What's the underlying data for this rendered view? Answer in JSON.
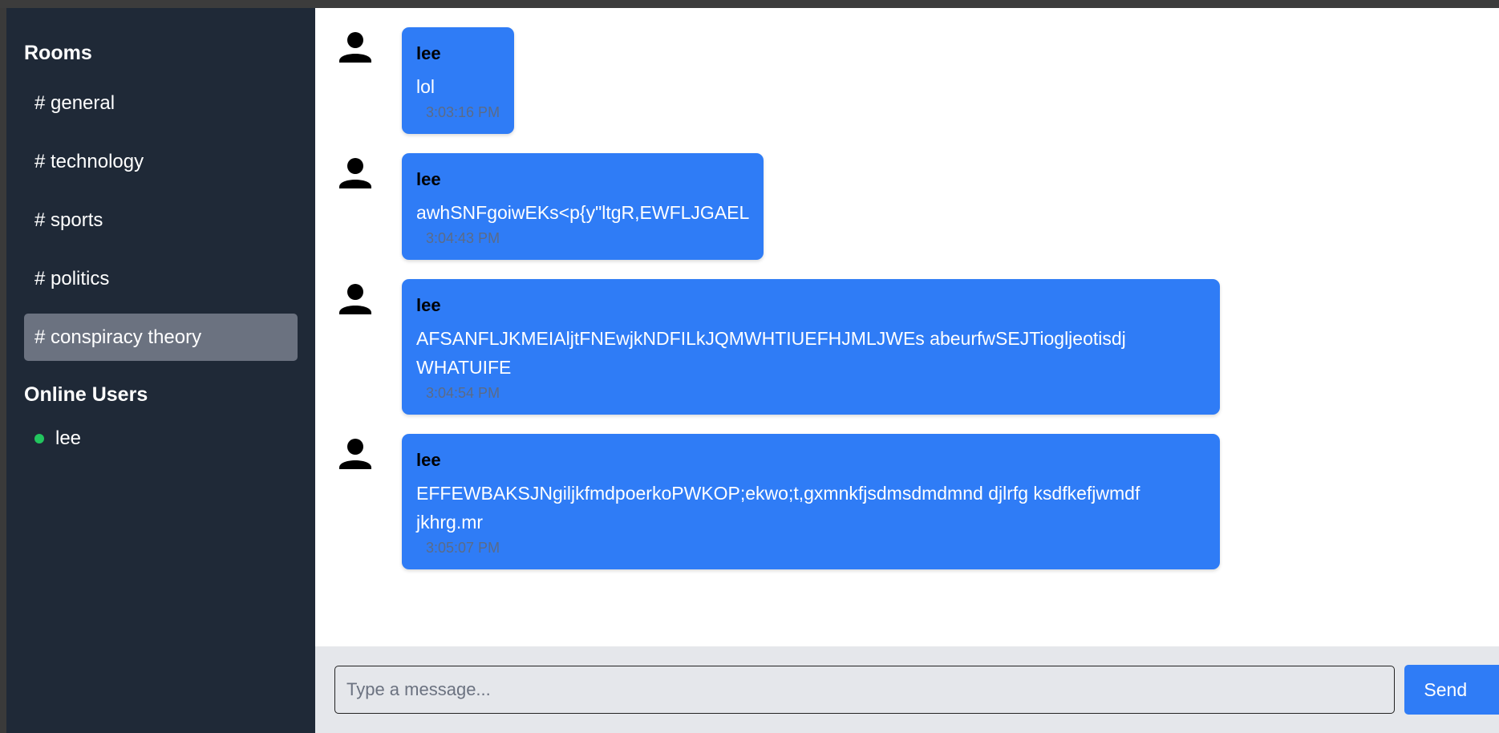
{
  "sidebar": {
    "rooms_title": "Rooms",
    "rooms": [
      {
        "label": "# general",
        "active": false
      },
      {
        "label": "# technology",
        "active": false
      },
      {
        "label": "# sports",
        "active": false
      },
      {
        "label": "# politics",
        "active": false
      },
      {
        "label": "# conspiracy theory",
        "active": true
      }
    ],
    "users_title": "Online Users",
    "users": [
      {
        "name": "lee",
        "status_color": "#22c55e"
      }
    ]
  },
  "messages": [
    {
      "sender": "lee",
      "text": "lol",
      "time": "3:03:16 PM"
    },
    {
      "sender": "lee",
      "text": "awhSNFgoiwEKs<p{y\"ltgR,EWFLJGAEL",
      "time": "3:04:43 PM"
    },
    {
      "sender": "lee",
      "text": "AFSANFLJKMEIAljtFNEwjkNDFILkJQMWHTIUEFHJMLJWEs abeurfwSEJTioglje​otisdj WHATUIFE",
      "time": "3:04:54 PM"
    },
    {
      "sender": "lee",
      "text": "EFFEWBAKSJNgiljkfmdpoerkoPWKOP;ekwo;t,gxmnkfjsdmsdmdmnd djlrfg ksdfkefjwmdf jkhrg.mr",
      "time": "3:05:07 PM"
    }
  ],
  "composer": {
    "placeholder": "Type a message...",
    "send_label": "Send"
  },
  "colors": {
    "sidebar_bg": "#1f2937",
    "active_room_bg": "#6b7280",
    "bubble_bg": "#2f7cf6",
    "online": "#22c55e"
  }
}
